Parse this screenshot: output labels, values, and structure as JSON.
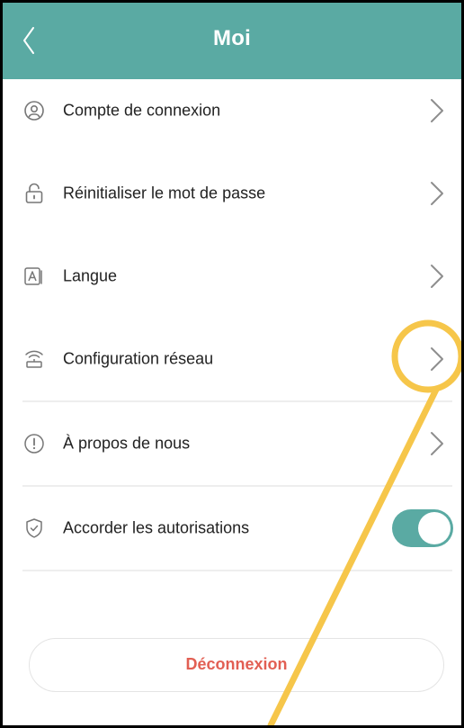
{
  "header": {
    "title": "Moi",
    "back_icon": "chevron-left-icon",
    "background": "#5aaaa3"
  },
  "menu": {
    "items": [
      {
        "label": "Compte de connexion",
        "icon": "user-circle-icon",
        "trailing": "chevron"
      },
      {
        "label": "Réinitialiser le mot de passe",
        "icon": "lock-icon",
        "trailing": "chevron"
      },
      {
        "label": "Langue",
        "icon": "language-icon",
        "trailing": "chevron"
      },
      {
        "label": "Configuration réseau",
        "icon": "router-icon",
        "trailing": "chevron"
      },
      {
        "label": "À propos de nous",
        "icon": "info-icon",
        "trailing": "chevron"
      },
      {
        "label": "Accorder les autorisations",
        "icon": "shield-check-icon",
        "trailing": "toggle",
        "toggle_on": true
      }
    ]
  },
  "logout": {
    "label": "Déconnexion",
    "color": "#e25f53"
  },
  "annotation": {
    "type": "highlight-circle-with-pointer",
    "color": "#f6c64a",
    "target": "Configuration réseau chevron"
  },
  "colors": {
    "accent": "#5aaaa3",
    "danger": "#e25f53",
    "highlight": "#f6c64a"
  }
}
